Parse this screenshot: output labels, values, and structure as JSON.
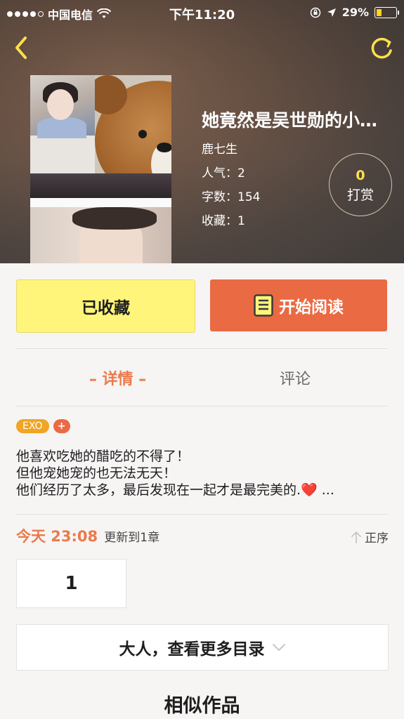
{
  "status_bar": {
    "carrier": "中国电信",
    "time": "下午11:20",
    "battery": "29%"
  },
  "colors": {
    "accent_orange": "#ea6a43",
    "fav_yellow": "#fef57a",
    "tag_orange": "#f0a524",
    "tip_count": "#ffe14d"
  },
  "book": {
    "title": "她竟然是吴世勋的小…",
    "author": "鹿七生",
    "popularity": "人气：2",
    "word_count": "字数：154",
    "favorites": "收藏：1",
    "tip_count": "0",
    "tip_label": "打赏"
  },
  "actions": {
    "favorited_label": "已收藏",
    "read_label": "开始阅读"
  },
  "tabs": {
    "detail": "– 详情 –",
    "comment": "评论"
  },
  "tags": [
    "EXO",
    "+"
  ],
  "description": {
    "line1": "他喜欢吃她的醋吃的不得了！",
    "line2": "但他宠她宠的也无法无天！",
    "line3_text": "他们经历了太多，最后发现在一起才是最完美的.",
    "line3_heart": "❤️",
    "line3_ellipsis": " ..."
  },
  "update": {
    "time": "今天 23:08",
    "note": "更新到1章",
    "order_label": "正序"
  },
  "chapters": [
    "1"
  ],
  "more_catalog": "大人，查看更多目录",
  "similar_title": "相似作品",
  "icons": {
    "back": "chevron-left-icon",
    "refresh": "refresh-icon",
    "wifi": "wifi-icon",
    "lock_rotation": "orientation-lock-icon",
    "location": "location-arrow-icon",
    "book": "book-icon",
    "sort": "arrow-up-icon",
    "expand": "chevron-down-icon"
  }
}
